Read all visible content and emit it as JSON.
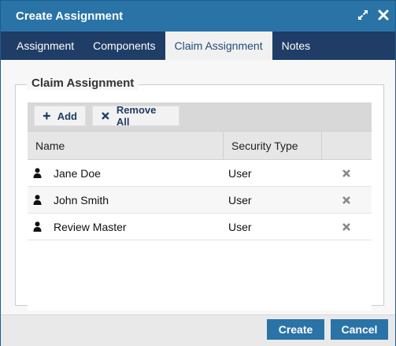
{
  "dialog": {
    "title": "Create Assignment"
  },
  "tabs": [
    {
      "label": "Assignment"
    },
    {
      "label": "Components"
    },
    {
      "label": "Claim Assignment"
    },
    {
      "label": "Notes"
    }
  ],
  "active_tab": "Claim Assignment",
  "section": {
    "legend": "Claim Assignment"
  },
  "toolbar": {
    "add_label": "Add",
    "remove_all_label": "Remove All"
  },
  "grid": {
    "headers": [
      "Name",
      "Security Type"
    ],
    "rows": [
      {
        "name": "Jane Doe",
        "security_type": "User"
      },
      {
        "name": "John Smith",
        "security_type": "User"
      },
      {
        "name": "Review Master",
        "security_type": "User"
      }
    ]
  },
  "footer": {
    "create_label": "Create",
    "cancel_label": "Cancel"
  },
  "colors": {
    "title_bar": "#2a73a7",
    "tab_bar": "#1f3d66",
    "primary_button": "#2a73a7"
  },
  "icons": {
    "maximize": "expand-arrows-icon",
    "close": "close-x-icon",
    "add": "plus-icon",
    "remove_all": "x-icon",
    "row_user": "user-icon",
    "row_delete": "x-icon"
  }
}
